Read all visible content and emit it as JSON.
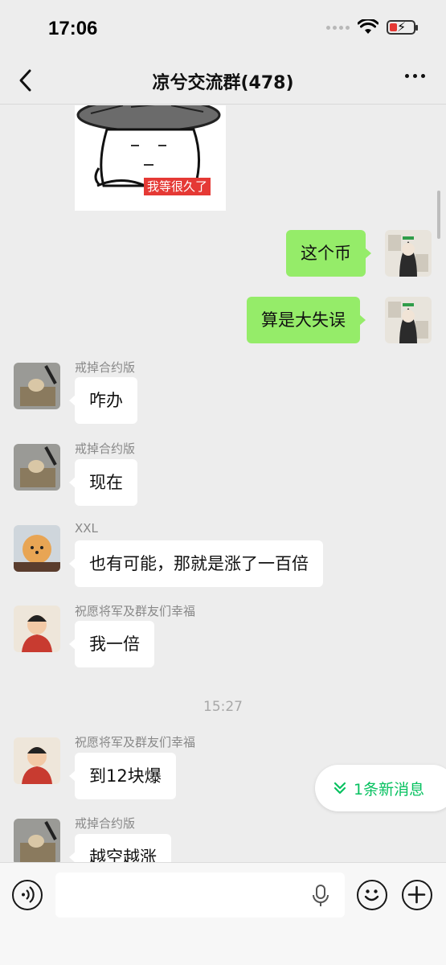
{
  "status_bar": {
    "time": "17:06"
  },
  "nav": {
    "title": "凉兮交流群(478)"
  },
  "sticker": {
    "caption": "我等很久了"
  },
  "messages": [
    {
      "side": "right",
      "text": "这个币"
    },
    {
      "side": "right",
      "text": "算是大失误"
    },
    {
      "side": "left",
      "sender": "戒掉合约版",
      "text": "咋办"
    },
    {
      "side": "left",
      "sender": "戒掉合约版",
      "text": "现在"
    },
    {
      "side": "left",
      "sender": "XXL",
      "text": "也有可能，那就是涨了一百倍"
    },
    {
      "side": "left",
      "sender": "祝愿将军及群友们幸福",
      "text": "我一倍"
    },
    {
      "side": "left",
      "sender": "祝愿将军及群友们幸福",
      "text": "到12块爆"
    },
    {
      "side": "left",
      "sender": "戒掉合约版",
      "text": "越空越涨"
    }
  ],
  "timestamp": "15:27",
  "new_messages": {
    "label": "1条新消息"
  },
  "icons": {
    "back": "back-chevron-icon",
    "more": "more-dots-icon",
    "voice": "voice-icon",
    "mic": "mic-icon",
    "emoji": "emoji-icon",
    "plus": "plus-icon",
    "new_msg": "double-chevron-down-icon"
  },
  "colors": {
    "self_bubble": "#95ec69",
    "other_bubble": "#ffffff",
    "background": "#ededed",
    "accent": "#07c160",
    "sticker_caption_bg": "#e53935"
  }
}
